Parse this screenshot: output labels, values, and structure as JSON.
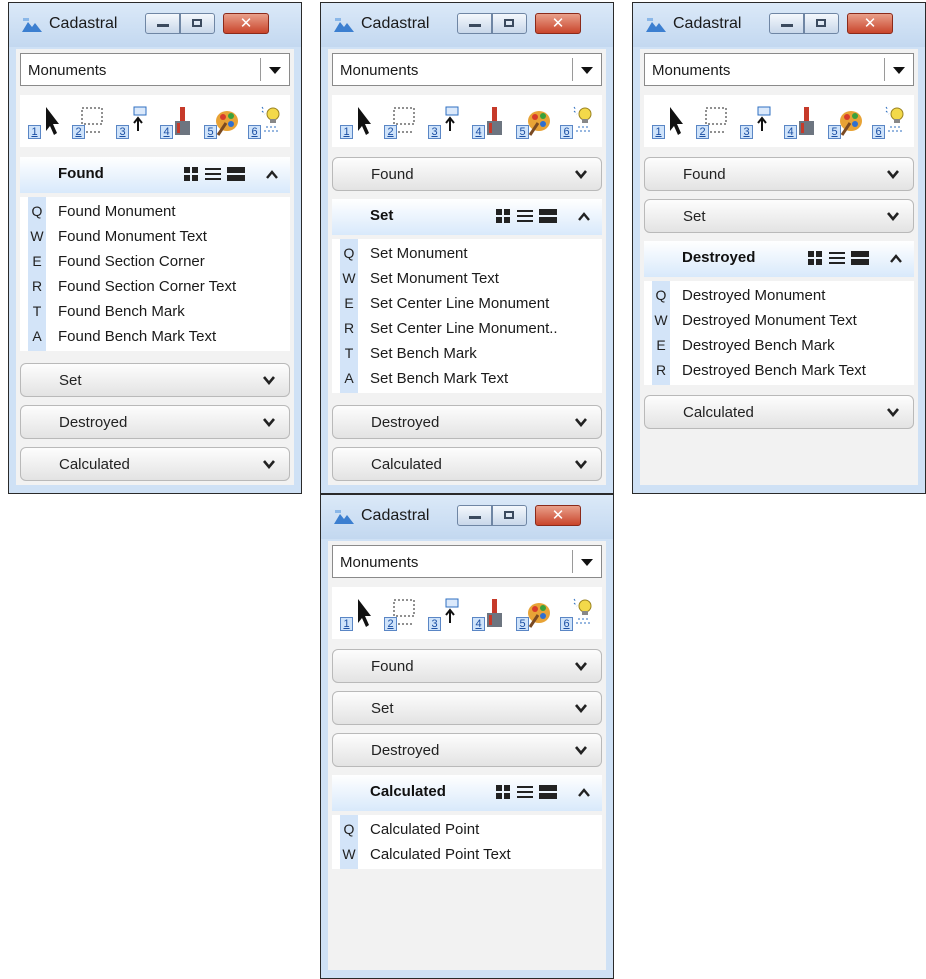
{
  "window_title": "Cadastral",
  "combo_value": "Monuments",
  "tools": [
    "1",
    "2",
    "3",
    "4",
    "5",
    "6"
  ],
  "close_glyph": "✕",
  "sections": {
    "found": "Found",
    "set": "Set",
    "destroyed": "Destroyed",
    "calculated": "Calculated"
  },
  "found_items": [
    {
      "key": "Q",
      "label": "Found Monument"
    },
    {
      "key": "W",
      "label": "Found Monument Text"
    },
    {
      "key": "E",
      "label": "Found Section Corner"
    },
    {
      "key": "R",
      "label": "Found Section Corner Text"
    },
    {
      "key": "T",
      "label": "Found Bench Mark"
    },
    {
      "key": "A",
      "label": "Found Bench Mark Text"
    }
  ],
  "set_items": [
    {
      "key": "Q",
      "label": "Set Monument"
    },
    {
      "key": "W",
      "label": "Set Monument Text"
    },
    {
      "key": "E",
      "label": "Set Center Line Monument"
    },
    {
      "key": "R",
      "label": "Set Center Line Monument.."
    },
    {
      "key": "T",
      "label": "Set Bench Mark"
    },
    {
      "key": "A",
      "label": "Set Bench Mark Text"
    }
  ],
  "destroyed_items": [
    {
      "key": "Q",
      "label": "Destroyed Monument"
    },
    {
      "key": "W",
      "label": "Destroyed Monument Text"
    },
    {
      "key": "E",
      "label": "Destroyed Bench Mark"
    },
    {
      "key": "R",
      "label": "Destroyed Bench Mark Text"
    }
  ],
  "calculated_items": [
    {
      "key": "Q",
      "label": "Calculated Point"
    },
    {
      "key": "W",
      "label": "Calculated Point Text"
    }
  ],
  "colors": {
    "accent_key": "#d3e4f8",
    "title_bar": "#cfe1f5",
    "close": "#c9452b"
  }
}
